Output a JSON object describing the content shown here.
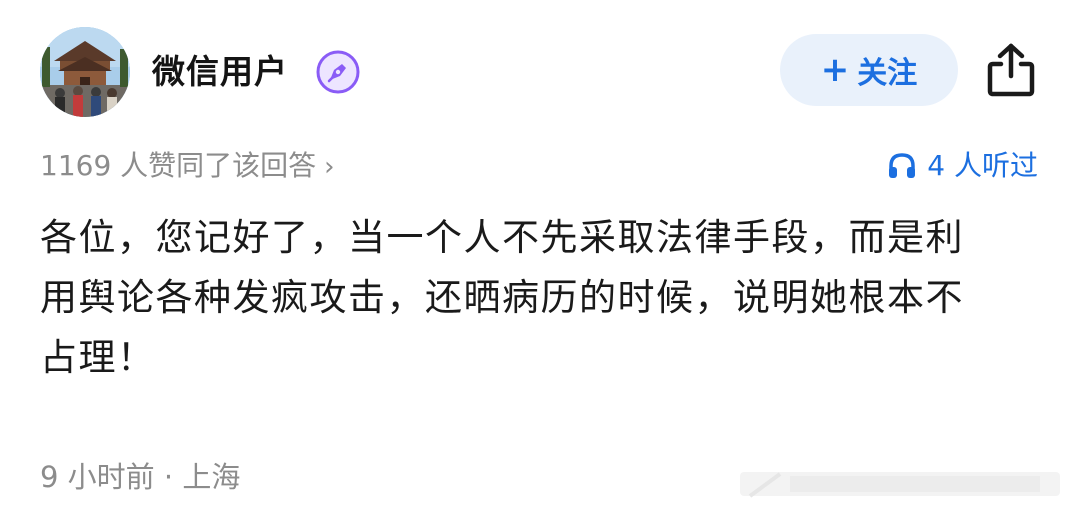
{
  "header": {
    "username": "微信用户",
    "avatar_icon": "temple-photo-avatar",
    "badge_icon": "pen-nib-badge-icon",
    "badge_color": "#8a5cf6",
    "follow_label": "关注",
    "follow_plus": "+",
    "share_icon": "share-icon"
  },
  "meta": {
    "likes_text": "1169 人赞同了该回答",
    "likes_chevron": "›",
    "listens_icon": "headphones-icon",
    "listens_text": "4 人听过",
    "accent_color": "#1c6fe0"
  },
  "post": {
    "lines": [
      "各位，您记好了，当一个人不先采取法律手段，而是利",
      "用舆论各种发疯攻击，还晒病历的时候，说明她根本不",
      "占理！"
    ]
  },
  "footer": {
    "time_location": "9 小时前 · 上海"
  }
}
